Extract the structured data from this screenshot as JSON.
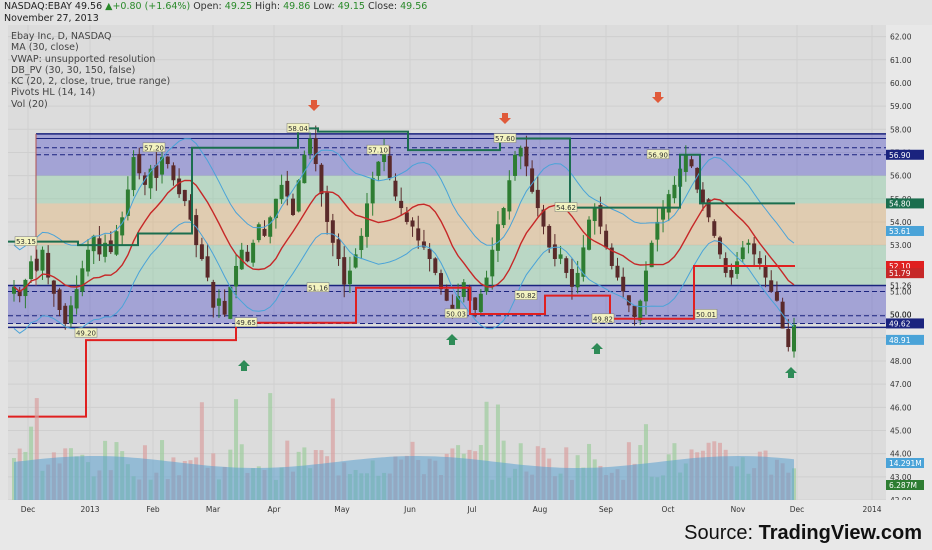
{
  "header": {
    "symbol": "NASDAQ:EBAY",
    "last": "49.56",
    "change": "+0.80 (+1.64%)",
    "open_label": "Open:",
    "open": "49.25",
    "high_label": "High:",
    "high": "49.86",
    "low_label": "Low:",
    "low": "49.15",
    "close_label": "Close:",
    "close": "49.56",
    "date": "November 27, 2013"
  },
  "indicators": [
    "Ebay Inc, D, NASDAQ",
    "MA (30, close)",
    "VWAP: unsupported resolution",
    "DB_PV (30, 30, 150, false)",
    "KC (20, 2, close, true, true range)",
    "Pivots HL (14, 14)",
    "Vol (20)"
  ],
  "source": {
    "label": "Source:",
    "brand": "TradingView.com"
  },
  "colors": {
    "up_candle": "#2e7d32",
    "down_candle": "#5a2a2a",
    "ma_line": "#c62828",
    "keltner": "#4aa3d8",
    "pivot_high": "#1b6e4e",
    "pivot_low": "#e02020",
    "zone_blue": "#3a3ac8",
    "zone_green": "#7ccf9a",
    "zone_orange": "#e8b060",
    "volume": "#5aa0d0",
    "arrow_up": "#2e8b57",
    "arrow_down": "#e05a3a"
  },
  "chart_data": {
    "type": "candlestick",
    "y_axis": {
      "range": [
        42.0,
        62.5
      ],
      "ticks": [
        "62.00",
        "61.00",
        "60.00",
        "59.00",
        "58.00",
        "57.00",
        "56.00",
        "55.00",
        "54.00",
        "53.00",
        "52.00",
        "51.00",
        "50.00",
        "49.00",
        "48.00",
        "47.00",
        "46.00",
        "45.00",
        "44.00",
        "43.00",
        "42.00"
      ]
    },
    "x_axis": {
      "ticks": [
        "Dec",
        "2013",
        "Feb",
        "Mar",
        "Apr",
        "May",
        "Jun",
        "Jul",
        "Aug",
        "Sep",
        "Oct",
        "Nov",
        "Dec",
        "2014"
      ]
    },
    "price_marks": [
      {
        "value": 56.9,
        "label": "56.90",
        "color": "#1a237e"
      },
      {
        "value": 54.8,
        "label": "54.80",
        "color": "#1b6e4e"
      },
      {
        "value": 53.61,
        "label": "53.61",
        "color": "#4aa3d8"
      },
      {
        "value": 52.1,
        "label": "52.10",
        "color": "#e02020"
      },
      {
        "value": 51.79,
        "label": "51.79",
        "color": "#c62828"
      },
      {
        "value": 49.62,
        "label": "49.62",
        "color": "#1a237e"
      },
      {
        "value": 48.91,
        "label": "48.91",
        "color": "#4aa3d8"
      },
      {
        "value": 14.291,
        "label": "14.291M",
        "color": "#4aa3d8",
        "panel": "volume"
      },
      {
        "value": 6.287,
        "label": "6.287M",
        "color": "#2e7d32",
        "panel": "volume"
      }
    ],
    "axis_plain_labels": [
      "51.26",
      "50.00"
    ],
    "pivot_labels": [
      {
        "label": "53.15",
        "x": "Dec",
        "y": 53.15
      },
      {
        "label": "49.20",
        "x": "2013",
        "y": 49.2
      },
      {
        "label": "57.20",
        "x": "Feb",
        "y": 57.2
      },
      {
        "label": "49.65",
        "x": "Mar",
        "y": 49.65
      },
      {
        "label": "58.04",
        "x": "Apr",
        "y": 58.04
      },
      {
        "label": "51.16",
        "x": "May",
        "y": 51.16
      },
      {
        "label": "57.10",
        "x": "May",
        "y": 57.1
      },
      {
        "label": "50.03",
        "x": "Jun",
        "y": 50.03
      },
      {
        "label": "57.60",
        "x": "Jul",
        "y": 57.6
      },
      {
        "label": "50.82",
        "x": "Aug",
        "y": 50.82
      },
      {
        "label": "54.62",
        "x": "Aug",
        "y": 54.62
      },
      {
        "label": "49.82",
        "x": "Sep",
        "y": 49.82
      },
      {
        "label": "56.90",
        "x": "Oct",
        "y": 56.9
      },
      {
        "label": "50.01",
        "x": "Oct",
        "y": 50.01
      }
    ],
    "levels": {
      "resistance_top": 57.8,
      "resistance_bottom": 56.9,
      "support_top": 51.26,
      "support_bottom": 49.62
    },
    "arrows_up": [
      "Mar",
      "Jun",
      "Sep",
      "Nov"
    ],
    "arrows_down": [
      "Apr",
      "Jul",
      "Sep"
    ],
    "close_series": [
      51.2,
      50.8,
      51.5,
      52.3,
      51.9,
      52.8,
      51.6,
      50.9,
      50.2,
      49.6,
      50.4,
      51.1,
      52.0,
      52.8,
      53.4,
      52.6,
      53.1,
      52.7,
      53.6,
      54.2,
      55.4,
      56.8,
      56.1,
      55.6,
      56.3,
      55.9,
      56.8,
      56.5,
      55.8,
      55.2,
      54.9,
      54.1,
      53.0,
      52.4,
      51.6,
      50.3,
      50.7,
      50.0,
      51.2,
      52.1,
      52.8,
      52.3,
      53.1,
      53.9,
      53.4,
      54.2,
      55.0,
      55.6,
      55.1,
      54.3,
      55.8,
      56.9,
      57.6,
      56.5,
      55.2,
      54.0,
      53.1,
      52.4,
      51.3,
      51.9,
      52.6,
      53.4,
      54.8,
      55.9,
      56.6,
      57.0,
      55.9,
      55.1,
      54.6,
      54.0,
      53.8,
      53.2,
      52.9,
      52.4,
      51.8,
      51.1,
      50.6,
      50.1,
      50.8,
      51.4,
      50.6,
      50.2,
      50.9,
      51.6,
      52.8,
      53.9,
      54.6,
      55.8,
      56.9,
      57.2,
      56.4,
      55.3,
      54.6,
      53.8,
      52.9,
      52.4,
      52.6,
      51.8,
      51.2,
      51.8,
      52.9,
      54.1,
      54.6,
      53.8,
      52.9,
      52.1,
      51.6,
      51.0,
      50.4,
      49.9,
      50.6,
      51.9,
      53.1,
      54.0,
      54.6,
      55.2,
      55.6,
      56.3,
      56.9,
      56.4,
      55.4,
      54.8,
      54.2,
      53.4,
      52.6,
      51.8,
      51.6,
      52.3,
      52.9,
      53.1,
      52.6,
      52.2,
      51.6,
      51.0,
      50.6,
      49.4,
      48.6,
      49.56
    ]
  }
}
